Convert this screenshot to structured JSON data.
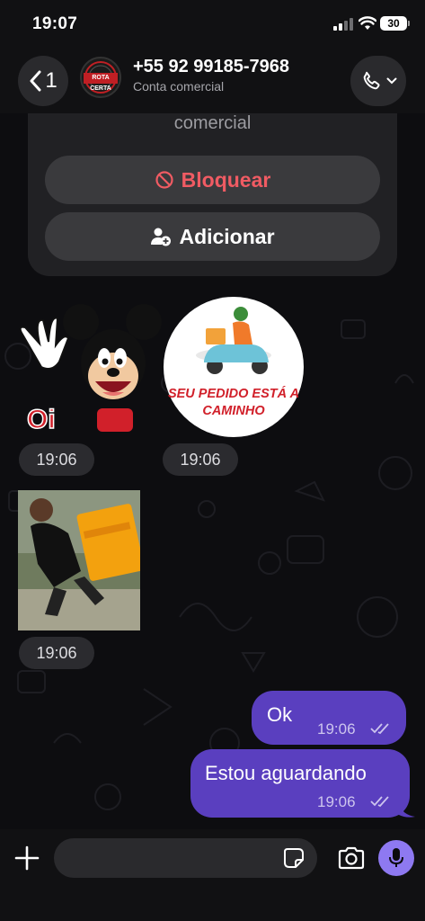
{
  "status_bar": {
    "time": "19:07",
    "battery": "30"
  },
  "header": {
    "back_count": "1",
    "avatar_text": "ROTA CERTA",
    "contact_name": "+55 92 99185-7968",
    "contact_subtitle": "Conta comercial"
  },
  "info_card": {
    "partial_text": "comercial",
    "block_label": "Bloquear",
    "add_label": "Adicionar"
  },
  "messages": {
    "sticker_1": {
      "caption": "Oi",
      "time": "19:06"
    },
    "sticker_2": {
      "caption_line1": "SEU PEDIDO ESTÁ A",
      "caption_line2": "CAMINHO",
      "time": "19:06"
    },
    "sticker_3": {
      "time": "19:06"
    },
    "outgoing_1": {
      "text": "Ok",
      "time": "19:06"
    },
    "outgoing_2": {
      "text": "Estou aguardando",
      "time": "19:06"
    }
  },
  "composer": {
    "placeholder": ""
  },
  "colors": {
    "accent": "#5a3fbf",
    "mic": "#8e79f1",
    "block_red": "#f05b63",
    "bubble": "#5a3fbf"
  },
  "icons": [
    "back-chevron-icon",
    "phone-icon",
    "chevron-down-icon",
    "block-icon",
    "add-contact-icon",
    "double-check-icon",
    "plus-icon",
    "sticker-icon",
    "camera-icon",
    "microphone-icon"
  ]
}
